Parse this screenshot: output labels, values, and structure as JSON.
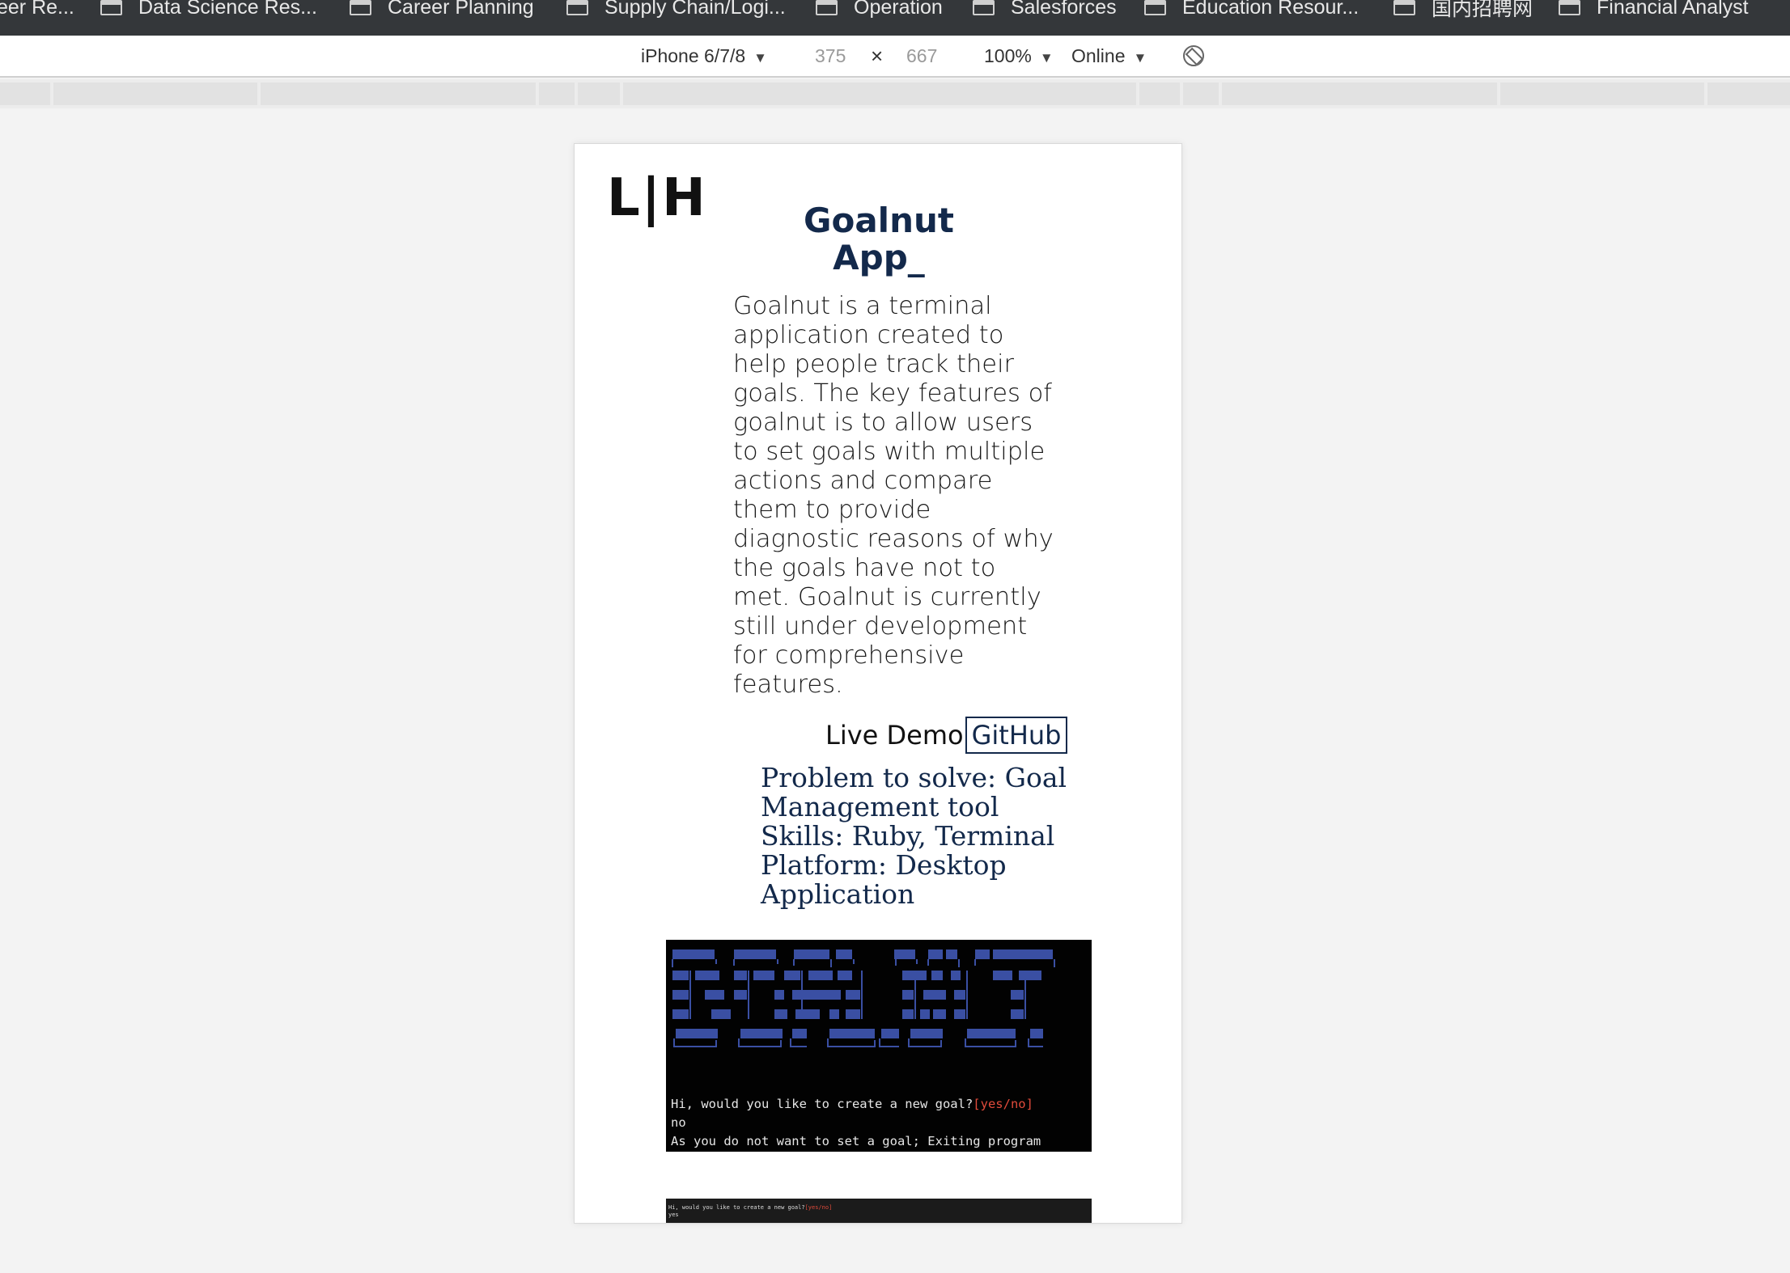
{
  "bookmarks": [
    {
      "label": "eer Re..."
    },
    {
      "label": "Data Science Res..."
    },
    {
      "label": "Career Planning"
    },
    {
      "label": "Supply Chain/Logi..."
    },
    {
      "label": "Operation"
    },
    {
      "label": "Salesforces"
    },
    {
      "label": "Education Resour..."
    },
    {
      "label": "国内招聘网"
    },
    {
      "label": "Financial Analyst"
    }
  ],
  "devtools": {
    "device": "iPhone 6/7/8",
    "width": "375",
    "times": "×",
    "height": "667",
    "zoom": "100%",
    "network": "Online",
    "caret": "▼"
  },
  "page": {
    "logo": "L|H",
    "title_line1": "Goalnut",
    "title_line2": "App_",
    "description": "Goalnut is a terminal application created to help people track their goals. The key features of goalnut is to allow users to set goals with multiple actions and compare them to provide diagnostic reasons of why the goals have not to met. Goalnut is currently still under development for comprehensive features.",
    "live_demo": "Live Demo",
    "github": "GitHub",
    "problem": "Problem to solve: Goal Management tool",
    "skills": "Skills: Ruby, Terminal",
    "platform": "Platform: Desktop Application"
  },
  "terminal": {
    "banner_color": "#3a4fa3",
    "question": "Hi, would you like to create a new goal?",
    "options": "[yes/no]",
    "answer": "no",
    "exit": "As you do not want to set a goal; Exiting program"
  },
  "terminal2": {
    "question": "Hi, would you like to create a new goal?",
    "options": "[yes/no]",
    "answer": "yes"
  }
}
